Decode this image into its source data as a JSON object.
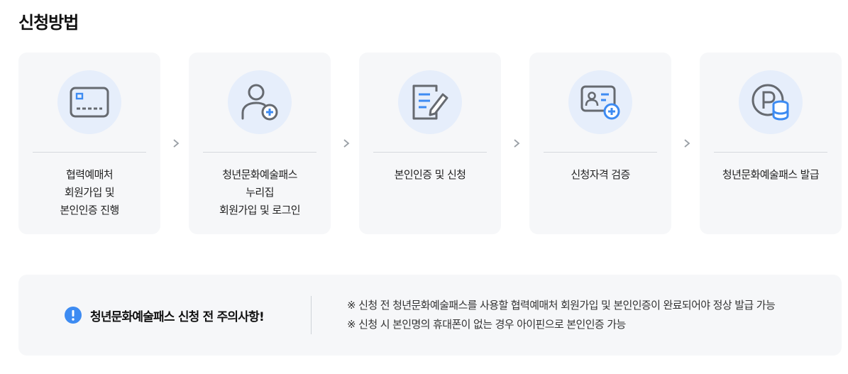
{
  "title": "신청방법",
  "steps": [
    {
      "text": "협력예매처\n회원가입 및\n본인인증 진행",
      "icon": "credit-card-icon"
    },
    {
      "text": "청년문화예술패스\n누리집\n회원가입 및 로그인",
      "icon": "user-add-icon"
    },
    {
      "text": "본인인증 및 신청",
      "icon": "document-edit-icon"
    },
    {
      "text": "신청자격 검증",
      "icon": "id-card-add-icon"
    },
    {
      "text": "청년문화예술패스 발급",
      "icon": "points-coin-icon"
    }
  ],
  "arrow_icon": "chevron-right-icon",
  "notice": {
    "icon": "exclamation-icon",
    "title": "청년문화예술패스 신청 전 주의사항!",
    "items": [
      "※ 신청 전 청년문화예술패스를 사용할 협력예매처 회원가입 및 본인인증이 완료되어야 정상 발급 가능",
      "※ 신청 시 본인명의 휴대폰이 없는 경우 아이핀으로 본인인증 가능"
    ]
  },
  "colors": {
    "accent": "#3d8bf2",
    "icon_gray": "#666a70",
    "card_bg": "#f6f7f9",
    "circle_bg": "#e6eefb"
  }
}
